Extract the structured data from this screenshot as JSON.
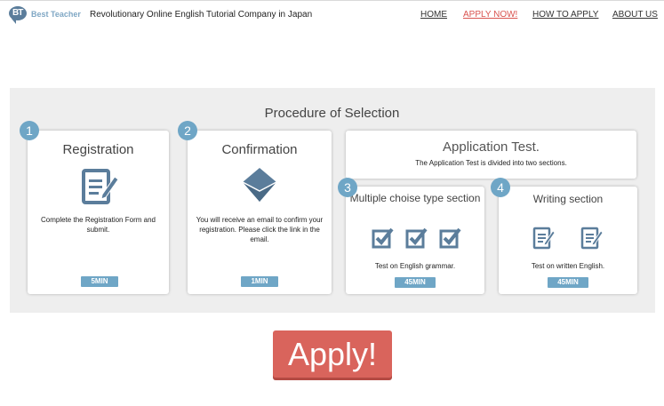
{
  "header": {
    "logo_text": "Best Teacher",
    "logo_mark_text": "BT",
    "tagline": "Revolutionary Online English Tutorial Company in Japan",
    "nav": [
      {
        "label": "HOME"
      },
      {
        "label": "APPLY NOW!"
      },
      {
        "label": "HOW TO APPLY"
      },
      {
        "label": "ABOUT US"
      }
    ]
  },
  "procedure": {
    "title": "Procedure of Selection",
    "steps": [
      {
        "number": "1",
        "title": "Registration",
        "description": "Complete the Registration Form and submit.",
        "duration": "5MIN",
        "icon": "document-pencil-icon"
      },
      {
        "number": "2",
        "title": "Confirmation",
        "description": "You will receive an email to confirm your registration. Please click the link in the email.",
        "duration": "1MIN",
        "icon": "envelope-icon"
      },
      {
        "number": "3",
        "title": "Multiple choise type section",
        "description": "Test on English grammar.",
        "duration": "45MIN",
        "icon": "checkbox-icon"
      },
      {
        "number": "4",
        "title": "Writing section",
        "description": "Test on written English.",
        "duration": "45MIN",
        "icon": "document-pencil-icon"
      }
    ],
    "application_test": {
      "title": "Application Test.",
      "description": "The Application Test is divided into two sections."
    }
  },
  "apply_button": {
    "label": "Apply!"
  },
  "colors": {
    "accent": "#6fa6c6",
    "apply": "#d9645c",
    "nav_highlight": "#d9534f",
    "icon": "#5b7d9b"
  }
}
